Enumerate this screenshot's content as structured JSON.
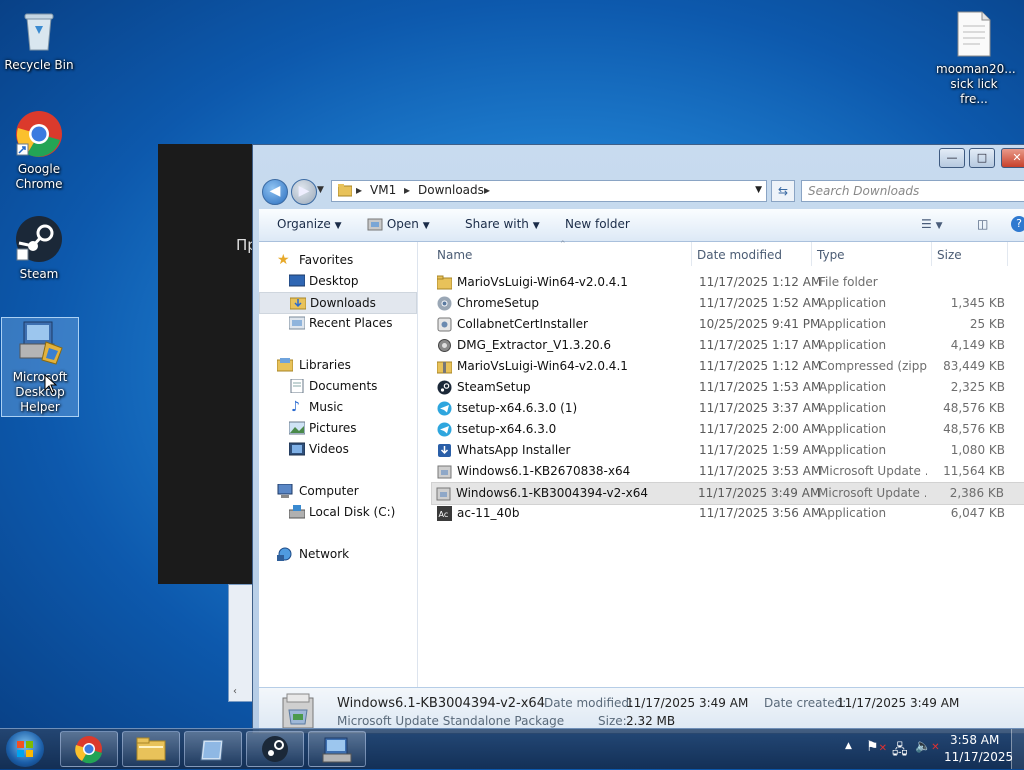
{
  "desktop": {
    "icons": [
      {
        "label": "Recycle Bin"
      },
      {
        "label": "Google Chrome"
      },
      {
        "label": "Steam"
      },
      {
        "label": "Microsoft Desktop Helper"
      },
      {
        "label": "mooman20... sick lick fre..."
      }
    ]
  },
  "background_window": {
    "text": "Пр"
  },
  "explorer": {
    "breadcrumb": [
      "VM1",
      "Downloads"
    ],
    "search_placeholder": "Search Downloads",
    "toolbar": {
      "organize": "Organize",
      "open": "Open",
      "share_with": "Share with",
      "new_folder": "New folder"
    },
    "nav": {
      "favorites": "Favorites",
      "desktop": "Desktop",
      "downloads": "Downloads",
      "recent_places": "Recent Places",
      "libraries": "Libraries",
      "documents": "Documents",
      "music": "Music",
      "pictures": "Pictures",
      "videos": "Videos",
      "computer": "Computer",
      "local_disk": "Local Disk (C:)",
      "network": "Network"
    },
    "columns": {
      "name": "Name",
      "date": "Date modified",
      "type": "Type",
      "size": "Size"
    },
    "files": [
      {
        "name": "MarioVsLuigi-Win64-v2.0.4.1",
        "date": "11/17/2025 1:12 AM",
        "type": "File folder",
        "size": "",
        "icon": "folder-icon"
      },
      {
        "name": "ChromeSetup",
        "date": "11/17/2025 1:52 AM",
        "type": "Application",
        "size": "1,345 KB",
        "icon": "chrome-setup-icon"
      },
      {
        "name": "CollabnetCertInstaller",
        "date": "10/25/2025 9:41 PM",
        "type": "Application",
        "size": "25 KB",
        "icon": "installer-icon"
      },
      {
        "name": "DMG_Extractor_V1.3.20.6",
        "date": "11/17/2025 1:17 AM",
        "type": "Application",
        "size": "4,149 KB",
        "icon": "gear-app-icon"
      },
      {
        "name": "MarioVsLuigi-Win64-v2.0.4.1",
        "date": "11/17/2025 1:12 AM",
        "type": "Compressed (zipp...",
        "size": "83,449 KB",
        "icon": "zip-folder-icon"
      },
      {
        "name": "SteamSetup",
        "date": "11/17/2025 1:53 AM",
        "type": "Application",
        "size": "2,325 KB",
        "icon": "steam-icon"
      },
      {
        "name": "tsetup-x64.6.3.0 (1)",
        "date": "11/17/2025 3:37 AM",
        "type": "Application",
        "size": "48,576 KB",
        "icon": "telegram-icon"
      },
      {
        "name": "tsetup-x64.6.3.0",
        "date": "11/17/2025 2:00 AM",
        "type": "Application",
        "size": "48,576 KB",
        "icon": "telegram-icon"
      },
      {
        "name": "WhatsApp Installer",
        "date": "11/17/2025 1:59 AM",
        "type": "Application",
        "size": "1,080 KB",
        "icon": "download-icon"
      },
      {
        "name": "Windows6.1-KB2670838-x64",
        "date": "11/17/2025 3:53 AM",
        "type": "Microsoft Update ...",
        "size": "11,564 KB",
        "icon": "update-package-icon"
      },
      {
        "name": "Windows6.1-KB3004394-v2-x64",
        "date": "11/17/2025 3:49 AM",
        "type": "Microsoft Update ...",
        "size": "2,386 KB",
        "icon": "update-package-icon"
      },
      {
        "name": "ac-11_40b",
        "date": "11/17/2025 3:56 AM",
        "type": "Application",
        "size": "6,047 KB",
        "icon": "ac-app-icon"
      }
    ],
    "selected_index": 10,
    "details": {
      "name": "Windows6.1-KB3004394-v2-x64",
      "kind": "Microsoft Update Standalone Package",
      "date_modified_label": "Date modified:",
      "date_modified": "11/17/2025 3:49 AM",
      "date_created_label": "Date created:",
      "date_created": "11/17/2025 3:49 AM",
      "size_label": "Size:",
      "size": "2.32 MB"
    }
  },
  "taskbar": {
    "time": "3:58 AM",
    "date": "11/17/2025"
  }
}
